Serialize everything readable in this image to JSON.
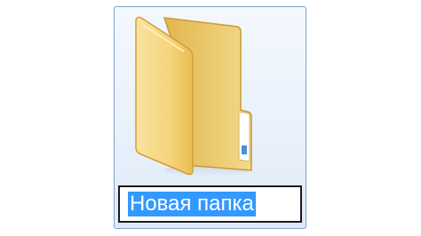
{
  "desktop": {
    "folder": {
      "icon": "folder-icon",
      "name": "Новая папка",
      "state": "renaming",
      "selection_color": "#3399ff",
      "item_border_color": "#7da2ce"
    }
  }
}
